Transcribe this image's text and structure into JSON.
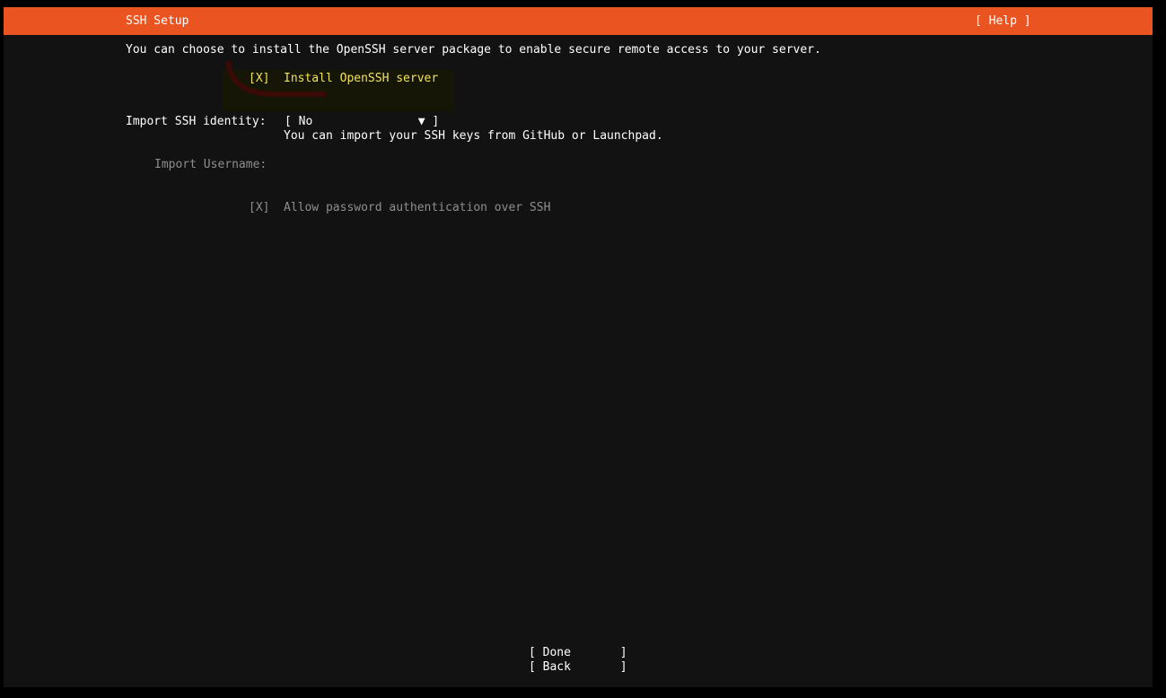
{
  "header": {
    "title": "SSH Setup",
    "help_label": "[ Help ]"
  },
  "intro_text": "You can choose to install the OpenSSH server package to enable secure remote access to your server.",
  "install_openssh": {
    "checkbox": "[X]",
    "label": "Install OpenSSH server"
  },
  "import_identity": {
    "label": "Import SSH identity:",
    "select_value": "[ No               ▼ ]",
    "help": "You can import your SSH keys from GitHub or Launchpad."
  },
  "import_username": {
    "label": "Import Username:"
  },
  "allow_password": {
    "checkbox": "[X]",
    "label": "Allow password authentication over SSH"
  },
  "buttons": {
    "done": "[ Done       ]",
    "back": "[ Back       ]"
  },
  "colors": {
    "header_bg": "#e95420",
    "screen_bg": "#121212",
    "focus_text": "#f1e35a",
    "disabled_text": "#8e8e8e"
  }
}
